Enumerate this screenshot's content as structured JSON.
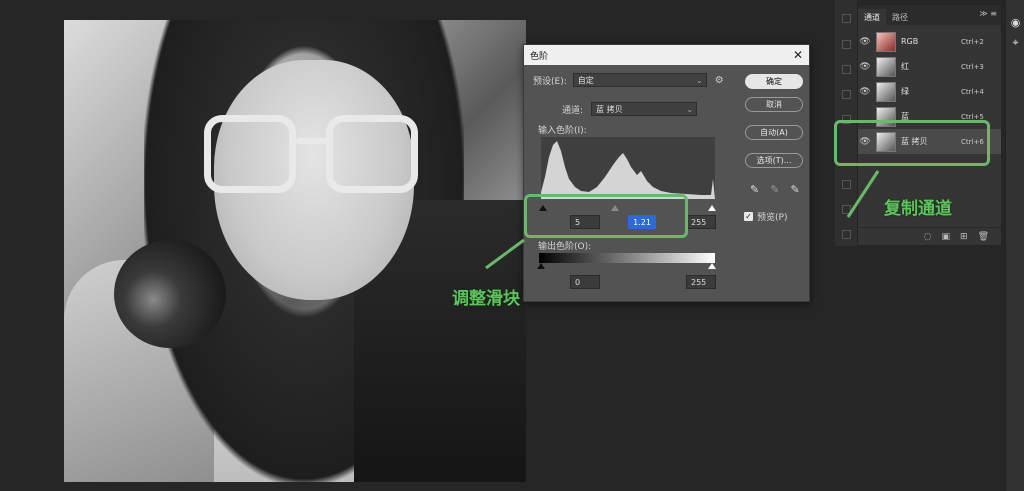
{
  "dialog": {
    "title": "色阶",
    "preset_label": "预设(E):",
    "preset_value": "自定",
    "channel_label": "通道:",
    "channel_value": "蓝 拷贝",
    "input_levels_label": "输入色阶(I):",
    "input_black": "5",
    "input_gamma": "1.21",
    "input_white": "255",
    "output_levels_label": "输出色阶(O):",
    "output_black": "0",
    "output_white": "255",
    "buttons": {
      "ok": "确定",
      "cancel": "取消",
      "auto": "自动(A)",
      "options": "选项(T)..."
    },
    "preview_label": "预览(P)",
    "preview_checked": true
  },
  "channels_panel": {
    "tabs": [
      "通道",
      "路径"
    ],
    "channels": [
      {
        "name": "RGB",
        "shortcut": "Ctrl+2",
        "visible": true
      },
      {
        "name": "红",
        "shortcut": "Ctrl+3",
        "visible": true
      },
      {
        "name": "绿",
        "shortcut": "Ctrl+4",
        "visible": true
      },
      {
        "name": "蓝",
        "shortcut": "Ctrl+5",
        "visible": false
      },
      {
        "name": "蓝 拷贝",
        "shortcut": "Ctrl+6",
        "visible": true,
        "selected": true
      }
    ]
  },
  "annotations": {
    "adjust_slider": "调整滑块",
    "copy_channel": "复制通道",
    "color": "#6bb86b"
  }
}
